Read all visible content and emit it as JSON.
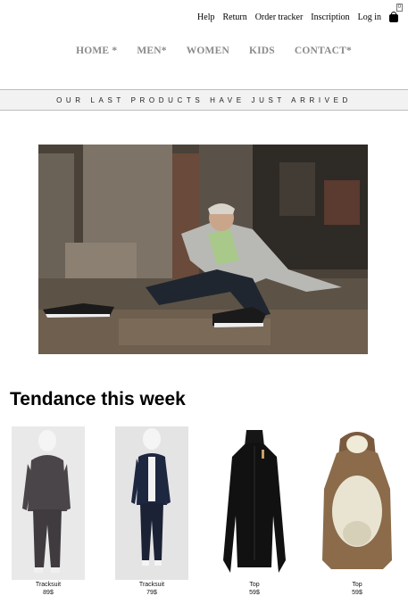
{
  "topnav": {
    "help": "Help",
    "return": "Return",
    "order_tracker": "Order tracker",
    "inscription": "Inscription",
    "login": "Log in",
    "cart_count": "0"
  },
  "mainnav": {
    "home": "HOME *",
    "men": "MEN*",
    "women": "WOMEN",
    "kids": "KIDS",
    "contact": "CONTACT*"
  },
  "banner": {
    "text": "OUR LAST PRODUCTS HAVE JUST ARRIVED"
  },
  "section": {
    "title": "Tendance this week"
  },
  "products": [
    {
      "name": "Tracksuit",
      "price": "89$"
    },
    {
      "name": "Tracksuit",
      "price": "79$"
    },
    {
      "name": "Top",
      "price": "59$"
    },
    {
      "name": "Top",
      "price": "59$"
    }
  ],
  "colors": {
    "nav_gray": "#8a8a8a",
    "banner_bg": "#f2f2f2"
  }
}
